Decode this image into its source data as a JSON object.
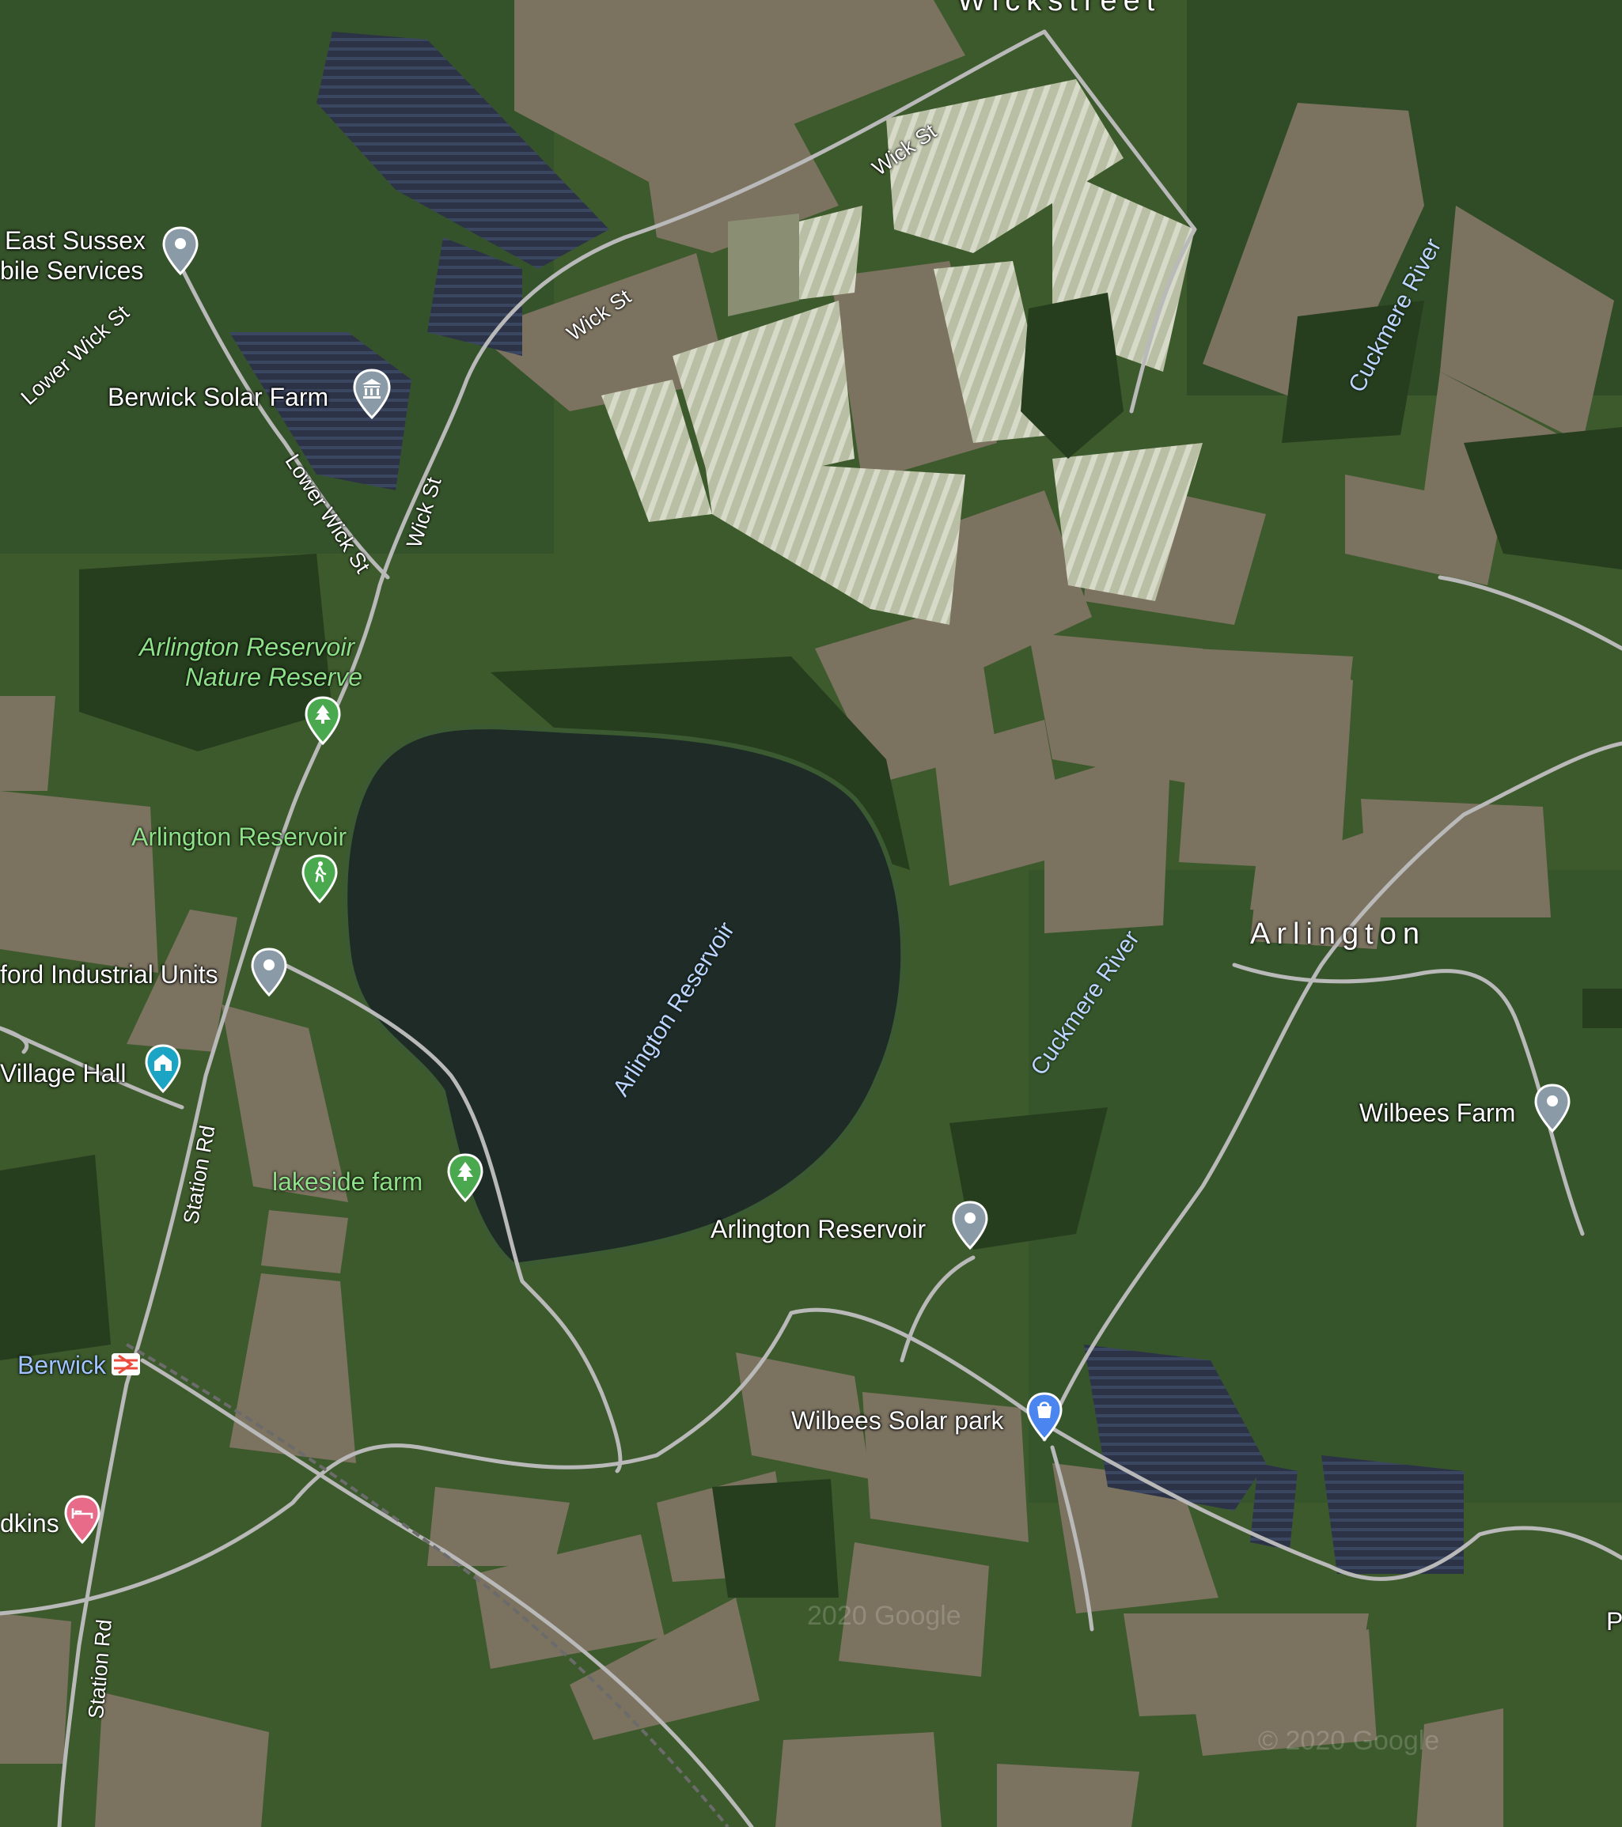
{
  "map": {
    "view": "satellite",
    "colors": {
      "pin_grey": "#8a9aa6",
      "pin_green": "#4aa84e",
      "pin_blue": "#4b86f0",
      "pin_pink": "#e86c8a",
      "rail_red": "#e94b3c",
      "road": "#b9b9b9",
      "water": "#1e2b27"
    },
    "places": [
      {
        "name": "East Sussex",
        "icon": "grey-pin-icon"
      },
      {
        "name": "bile Services",
        "icon": ""
      },
      {
        "name": "Berwick Solar Farm",
        "icon": "museum-pin-icon"
      },
      {
        "name": "Arlington Reservoir",
        "icon": ""
      },
      {
        "name": "Nature Reserve",
        "icon": "tree-pin-icon"
      },
      {
        "name": "Arlington Reservoir",
        "icon": "hiking-pin-icon"
      },
      {
        "name": "ford Industrial Units",
        "icon": "grey-pin-icon"
      },
      {
        "name": "Village Hall",
        "icon": "community-pin-icon"
      },
      {
        "name": "lakeside farm",
        "icon": "tree-pin-icon"
      },
      {
        "name": "Arlington Reservoir",
        "icon": "grey-pin-icon"
      },
      {
        "name": "Wilbees Farm",
        "icon": "grey-pin-icon"
      },
      {
        "name": "Wilbees Solar park",
        "icon": "shopping-pin-icon"
      },
      {
        "name": "Berwick",
        "icon": "rail-station-icon"
      },
      {
        "name": "dkins",
        "icon": "bed-pin-icon"
      }
    ],
    "roads": {
      "wick_st_1": "Wick St",
      "wick_st_2": "Wick St",
      "wick_st_3": "Wick St",
      "lower_wick_st_1": "Lower Wick St",
      "lower_wick_st_2": "Lower Wick St",
      "station_rd_1": "Station Rd",
      "station_rd_2": "Station Rd"
    },
    "water": {
      "reservoir": "Arlington Reservoir",
      "river_1": "Cuckmere River",
      "river_2": "Cuckmere River"
    },
    "towns": {
      "arlington": "Arlington",
      "wickstreet": "Wickstreet",
      "edge_letter": "P"
    },
    "watermarks": [
      "2020 Google",
      "© 2020 Google"
    ]
  }
}
